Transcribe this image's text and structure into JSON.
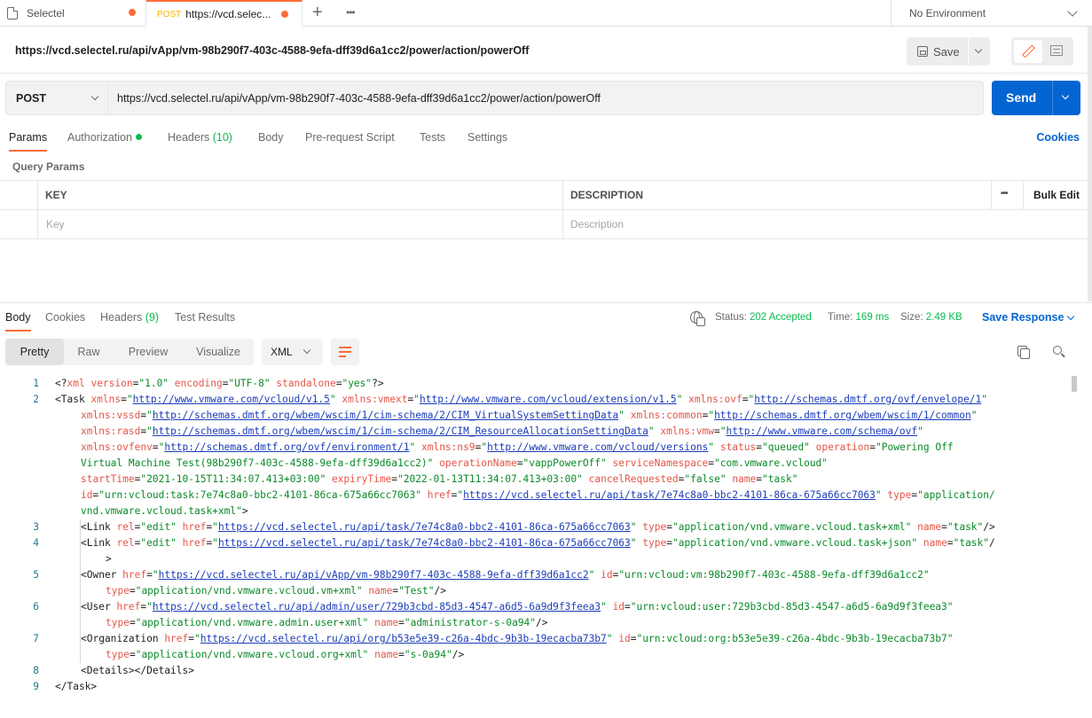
{
  "tabs": [
    {
      "label": "Selectel",
      "method": "",
      "unsaved": true
    },
    {
      "label": "https://vcd.selec...",
      "method": "POST",
      "unsaved": true
    }
  ],
  "environment": {
    "selected": "No Environment"
  },
  "request": {
    "title": "https://vcd.selectel.ru/api/vApp/vm-98b290f7-403c-4588-9efa-dff39d6a1cc2/power/action/powerOff",
    "method": "POST",
    "url": "https://vcd.selectel.ru/api/vApp/vm-98b290f7-403c-4588-9efa-dff39d6a1cc2/power/action/powerOff",
    "save_label": "Save",
    "send_label": "Send"
  },
  "request_tabs": {
    "params": "Params",
    "authorization": "Authorization",
    "headers": "Headers",
    "headers_count": "(10)",
    "body": "Body",
    "prerequest": "Pre-request Script",
    "tests": "Tests",
    "settings": "Settings",
    "cookies": "Cookies"
  },
  "query_params": {
    "title": "Query Params",
    "col_key": "KEY",
    "col_description": "DESCRIPTION",
    "more": "•••",
    "bulk_edit": "Bulk Edit",
    "key_placeholder": "Key",
    "description_placeholder": "Description"
  },
  "response_tabs": {
    "body": "Body",
    "cookies": "Cookies",
    "headers": "Headers",
    "headers_count": "(9)",
    "test_results": "Test Results"
  },
  "response_status": {
    "status_label": "Status:",
    "status_value": "202 Accepted",
    "time_label": "Time:",
    "time_value": "169 ms",
    "size_label": "Size:",
    "size_value": "2.49 KB",
    "save_response": "Save Response"
  },
  "view": {
    "modes": [
      "Pretty",
      "Raw",
      "Preview",
      "Visualize"
    ],
    "active_mode": "Pretty",
    "format": "XML"
  },
  "code_line_numbers": [
    "1",
    "2",
    "3",
    "4",
    "5",
    "6",
    "7",
    "8",
    "9"
  ]
}
